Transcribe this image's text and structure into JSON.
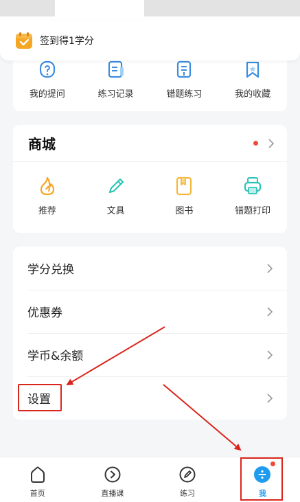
{
  "signin": {
    "text": "签到得1学分",
    "icon": "calendar-check-icon"
  },
  "study": {
    "items": [
      {
        "label": "我的提问",
        "icon": "question-icon"
      },
      {
        "label": "练习记录",
        "icon": "record-icon"
      },
      {
        "label": "错题练习",
        "icon": "wrong-practice-icon"
      },
      {
        "label": "我的收藏",
        "icon": "bookmark-icon"
      }
    ]
  },
  "shop": {
    "title": "商城",
    "items": [
      {
        "label": "推荐",
        "icon": "flame-icon",
        "color": "#f5a623"
      },
      {
        "label": "文具",
        "icon": "pencil-icon",
        "color": "#2bc3b5"
      },
      {
        "label": "图书",
        "icon": "book-icon",
        "color": "#f5b83d"
      },
      {
        "label": "错题打印",
        "icon": "printer-icon",
        "color": "#2bc3b5"
      }
    ]
  },
  "menu": {
    "items": [
      {
        "label": "学分兑换"
      },
      {
        "label": "优惠券"
      },
      {
        "label": "学币&余额"
      },
      {
        "label": "设置"
      }
    ]
  },
  "tabbar": {
    "items": [
      {
        "label": "首页",
        "icon": "home-icon"
      },
      {
        "label": "直播课",
        "icon": "play-circle-icon"
      },
      {
        "label": "练习",
        "icon": "compass-pen-icon"
      },
      {
        "label": "我",
        "icon": "me-icon",
        "active": true
      }
    ]
  },
  "colors": {
    "accent": "#1f9bf0",
    "badge": "#f04a3a",
    "annotation": "#d9261c"
  }
}
